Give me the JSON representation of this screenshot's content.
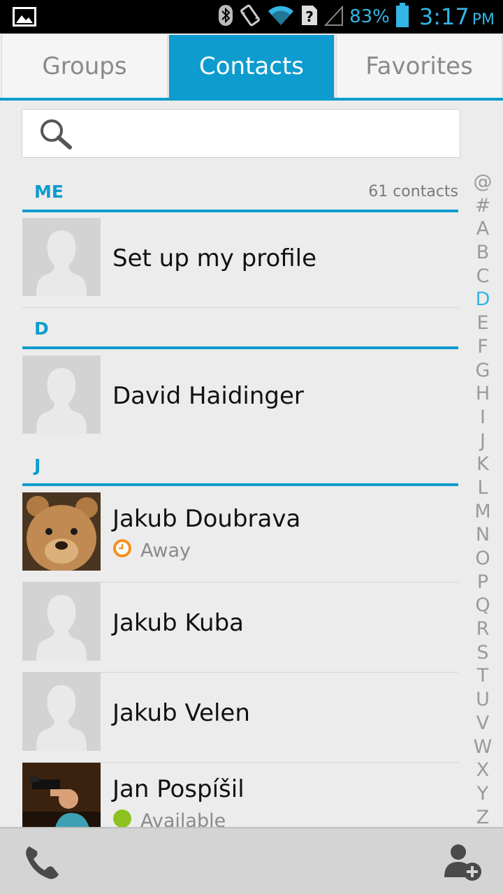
{
  "status_bar": {
    "battery_percent": "83%",
    "time": "3:17",
    "ampm": "PM",
    "icons": [
      "image-icon",
      "bluetooth-icon",
      "vibrate-icon",
      "wifi-icon",
      "sim-unknown-icon",
      "signal-icon",
      "battery-icon"
    ]
  },
  "tabs": [
    {
      "label": "Groups",
      "active": false
    },
    {
      "label": "Contacts",
      "active": true
    },
    {
      "label": "Favorites",
      "active": false
    }
  ],
  "search": {
    "placeholder": "",
    "value": ""
  },
  "sections": {
    "me": {
      "letter": "ME",
      "count": "61 contacts"
    },
    "d": {
      "letter": "D"
    },
    "j": {
      "letter": "J"
    }
  },
  "contacts": {
    "me_profile": {
      "name": "Set up my profile"
    },
    "david": {
      "name": "David Haidinger"
    },
    "jakub_doubrava": {
      "name": "Jakub Doubrava",
      "status": "Away",
      "status_color": "#f5901e"
    },
    "jakub_kuba": {
      "name": "Jakub Kuba"
    },
    "jakub_velen": {
      "name": "Jakub Velen"
    },
    "jan_pospisil": {
      "name": "Jan Pospíšil",
      "status": "Available",
      "status_color": "#8bc220"
    }
  },
  "index_letters": [
    "@",
    "#",
    "A",
    "B",
    "C",
    "D",
    "E",
    "F",
    "G",
    "H",
    "I",
    "J",
    "K",
    "L",
    "M",
    "N",
    "O",
    "P",
    "Q",
    "R",
    "S",
    "T",
    "U",
    "V",
    "W",
    "X",
    "Y",
    "Z"
  ],
  "index_highlight": "D",
  "colors": {
    "accent": "#0e9ccf",
    "holo_blue": "#33b5e5"
  },
  "bottom_bar": {
    "icons": [
      "phone-icon",
      "add-contact-icon"
    ]
  }
}
